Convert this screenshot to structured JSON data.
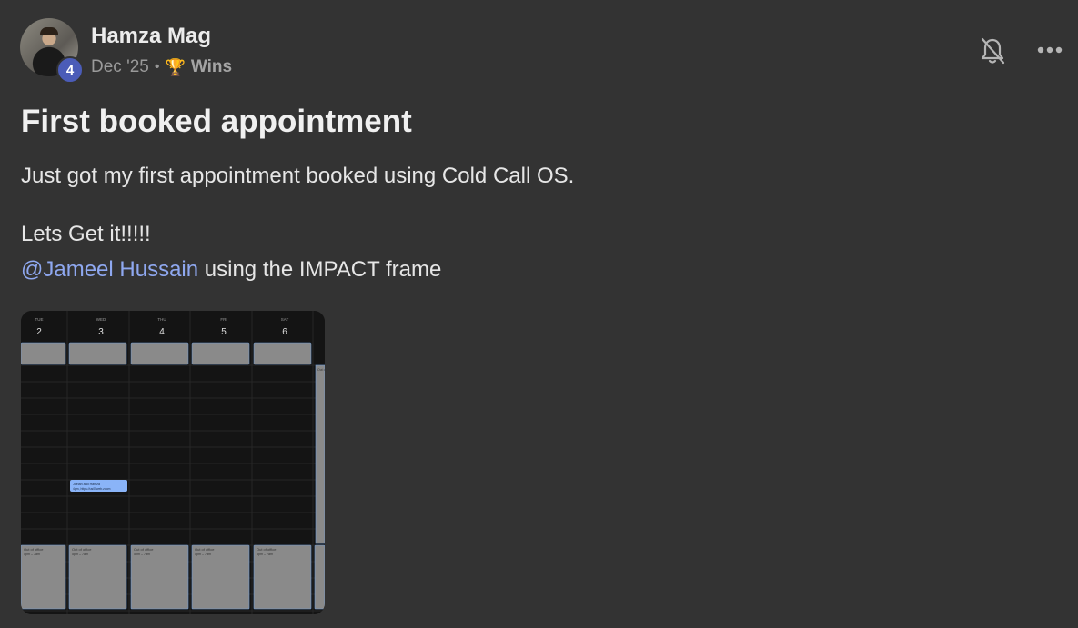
{
  "author": {
    "name": "Hamza Mag",
    "level": "4"
  },
  "meta": {
    "date": "Dec '25",
    "separator": "•",
    "category_icon": "trophy-icon",
    "category": "Wins"
  },
  "post": {
    "title": "First booked appointment",
    "paragraph1": "Just got my first appointment booked using Cold Call OS.",
    "paragraph2": "Lets Get it!!!!!",
    "mention": "@Jameel Hussain",
    "paragraph3_rest": " using the IMPACT frame"
  },
  "actions": {
    "bell": "bell-off-icon",
    "more": "more-icon"
  },
  "calendar": {
    "days": [
      {
        "dow": "TUE",
        "date": "2"
      },
      {
        "dow": "WED",
        "date": "3"
      },
      {
        "dow": "THU",
        "date": "4"
      },
      {
        "dow": "FRI",
        "date": "5"
      },
      {
        "dow": "SAT",
        "date": "6"
      }
    ],
    "event": {
      "title": "Joelah and Hamza",
      "subtitle": "4pm, https://us05web.zoom"
    },
    "ooo": {
      "title": "Out of office",
      "time": "5pm – 7am"
    }
  },
  "colors": {
    "background": "#333333",
    "mention": "#8fa8f0",
    "badge": "#4b5cb8",
    "event": "#8ab4f8"
  }
}
